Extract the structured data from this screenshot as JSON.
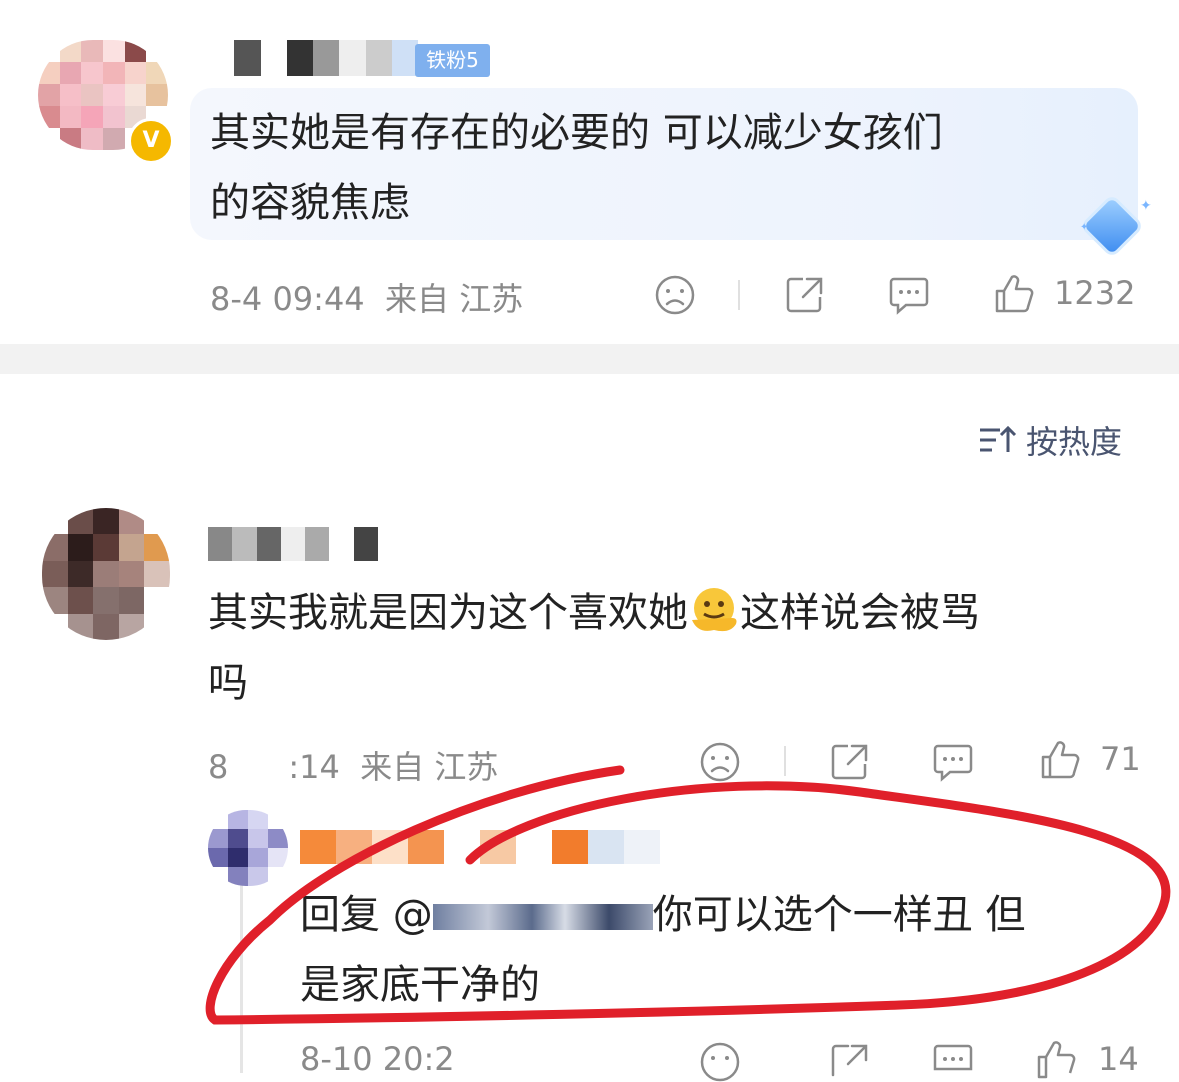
{
  "first_comment": {
    "avatar_label": "用户头像",
    "fan_badge": "铁粉5",
    "text_line1": "其实她是有存在的必要的 可以减少女孩们",
    "text_line2": "的容貌焦虑",
    "time": "8-4 09:44",
    "from_label": "来自",
    "location": "江苏",
    "like_count": "1232"
  },
  "sort": {
    "label": "按热度"
  },
  "second_comment": {
    "text_line1_a": "其实我就是因为这个喜欢她",
    "emoji": "melting-face",
    "text_line1_b": "这样说会被骂",
    "text_line2": "吗",
    "time": "8",
    "time_b": ":14",
    "from_label": "来自",
    "location": "江苏",
    "like_count": "71"
  },
  "reply": {
    "prefix": "回复 @",
    "text_line1": "你可以选个一样丑 但",
    "text_line2": "是家底干净的",
    "time": "8-10 20:2",
    "like_count": "14"
  },
  "colors": {
    "accent_blue": "#7fb0ee",
    "annotation_red": "#e0202a",
    "meta_gray": "#8a8a8a"
  }
}
